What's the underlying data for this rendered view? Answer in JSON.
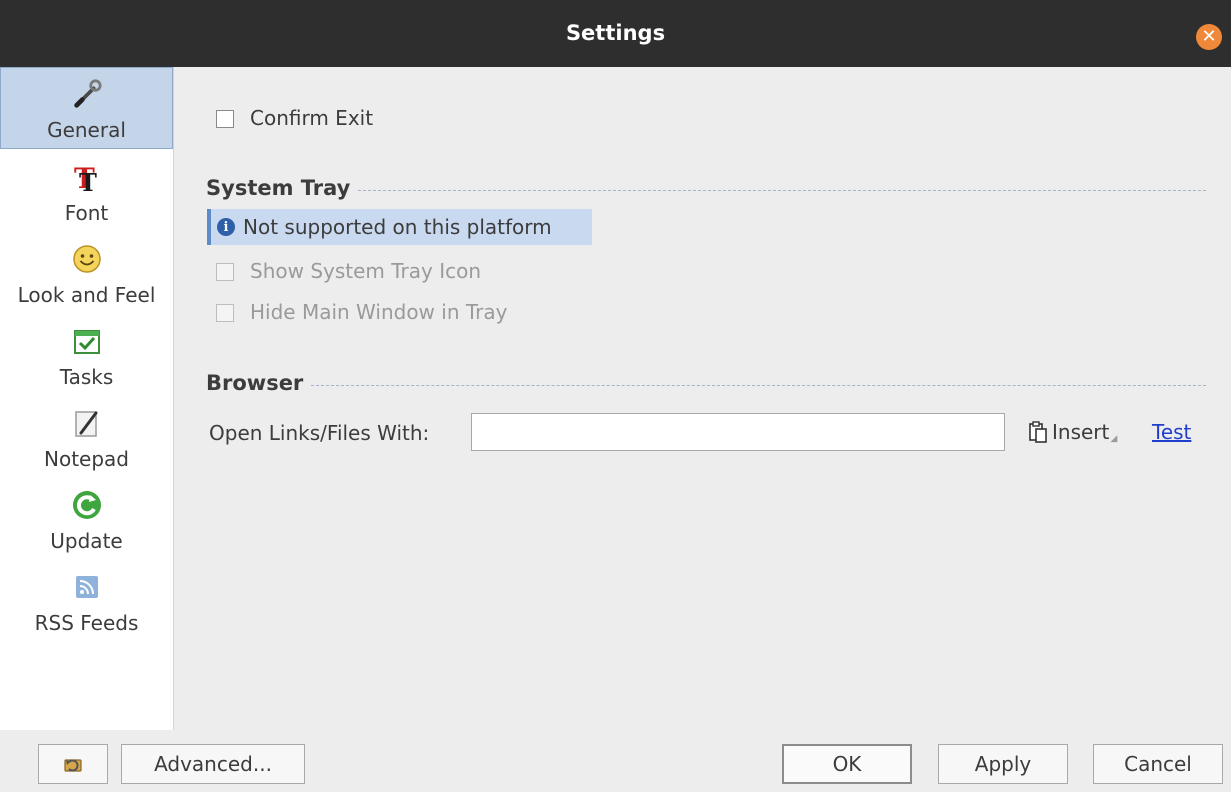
{
  "window": {
    "title": "Settings"
  },
  "sidebar": {
    "items": [
      {
        "label": "General",
        "icon": "wrench-icon"
      },
      {
        "label": "Font",
        "icon": "font-icon"
      },
      {
        "label": "Look and Feel",
        "icon": "smiley-icon"
      },
      {
        "label": "Tasks",
        "icon": "tasks-calendar-icon"
      },
      {
        "label": "Notepad",
        "icon": "notepad-icon"
      },
      {
        "label": "Update",
        "icon": "update-refresh-icon"
      },
      {
        "label": "RSS Feeds",
        "icon": "rss-icon"
      }
    ],
    "selected": "General"
  },
  "general": {
    "confirm_exit": {
      "label": "Confirm Exit",
      "mnemonic": "n",
      "checked": false
    },
    "system_tray": {
      "title": "System Tray",
      "info": "Not supported on this platform",
      "show_icon": {
        "label": "Show System Tray Icon",
        "mnemonic": "S",
        "checked": false,
        "enabled": false
      },
      "hide_main": {
        "label": "Hide Main Window in Tray",
        "mnemonic": "H",
        "checked": false,
        "enabled": false
      }
    },
    "browser": {
      "title": "Browser",
      "open_label": "Open Links/Files With:",
      "open_mnemonic": "e",
      "open_value": "",
      "insert_label": "Insert",
      "insert_mnemonic": "t",
      "test_label": "Test",
      "test_mnemonic": "T"
    }
  },
  "buttons": {
    "reset_icon": "restore-defaults-icon",
    "advanced": "Advanced...",
    "advanced_mnemonic": "d",
    "ok": "OK",
    "ok_mnemonic": "O",
    "apply": "Apply",
    "apply_mnemonic": "A",
    "cancel": "Cancel",
    "cancel_mnemonic": "C"
  },
  "colors": {
    "titlebar": "#2e2e2e",
    "close": "#f0883a",
    "selection": "#c4d5ea",
    "info_bar": "#c9daf0",
    "link": "#1f3ecc"
  }
}
